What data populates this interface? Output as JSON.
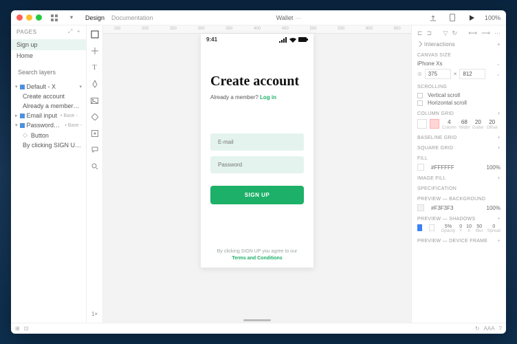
{
  "titlebar": {
    "tabs": [
      "Design",
      "Documentation"
    ],
    "doc_title": "Wallet",
    "zoom": "100%"
  },
  "pages": {
    "header": "PAGES",
    "items": [
      "Sign up",
      "Home"
    ],
    "search_placeholder": "Search layers"
  },
  "layers": [
    {
      "name": "Default - X",
      "blue": true,
      "caret": true,
      "tag": "",
      "indent": 0
    },
    {
      "name": "Create account",
      "indent": 1
    },
    {
      "name": "Already a member? ...",
      "indent": 1
    },
    {
      "name": "Email input",
      "blue": true,
      "caret": true,
      "tag": "• Base -",
      "indent": 0
    },
    {
      "name": "Password in...",
      "blue": true,
      "caret": true,
      "tag": "• Base -",
      "indent": 0
    },
    {
      "name": "Button",
      "indent": 1,
      "bullet": true
    },
    {
      "name": "By clicking SIGN UP ...",
      "indent": 1
    }
  ],
  "canvas": {
    "ruler": [
      "150",
      "200",
      "250",
      "300",
      "350",
      "400",
      "450",
      "500",
      "550",
      "600",
      "650"
    ],
    "phone": {
      "time": "9:41",
      "heading": "Create account",
      "member_text": "Already a member?",
      "login": "Log in",
      "email_placeholder": "E-mail",
      "password_placeholder": "Password",
      "signup_btn": "SIGN UP",
      "terms_pre": "By clicking SIGN UP you agree to our",
      "terms_link": "Terms and Conditions"
    }
  },
  "inspector": {
    "interactions": "Interactions",
    "canvas_size": {
      "label": "CANVAS SIZE",
      "device": "iPhone Xs",
      "w": "375",
      "h": "812"
    },
    "scrolling": {
      "label": "SCROLLING",
      "v": "Vertical scroll",
      "h": "Horizontal scroll"
    },
    "column_grid": {
      "label": "COLUMN GRID",
      "columns": "4",
      "width": "68",
      "gutter": "20",
      "offset": "20",
      "labels": [
        "Column",
        "Width",
        "Gutter",
        "Offset"
      ]
    },
    "baseline": "BASELINE GRID",
    "square": "SQUARE GRID",
    "fill": {
      "label": "FILL",
      "hex": "#FFFFFF",
      "opacity": "100%"
    },
    "image_fill": "IMAGE FILL",
    "specification": "SPECIFICATION",
    "preview_bg": {
      "label": "PREVIEW — BACKGROUND",
      "hex": "#F3F3F3",
      "opacity": "100%"
    },
    "preview_shadow": {
      "label": "PREVIEW — SHADOWS",
      "opacity": "5%",
      "y": "0",
      "x": "10",
      "blur": "50",
      "spread": "0",
      "labels": [
        "Opacity",
        "Y",
        "X",
        "Blur",
        "Spread"
      ]
    },
    "preview_device": "PREVIEW — DEVICE FRAME"
  },
  "footer": {
    "text": "AAA"
  }
}
